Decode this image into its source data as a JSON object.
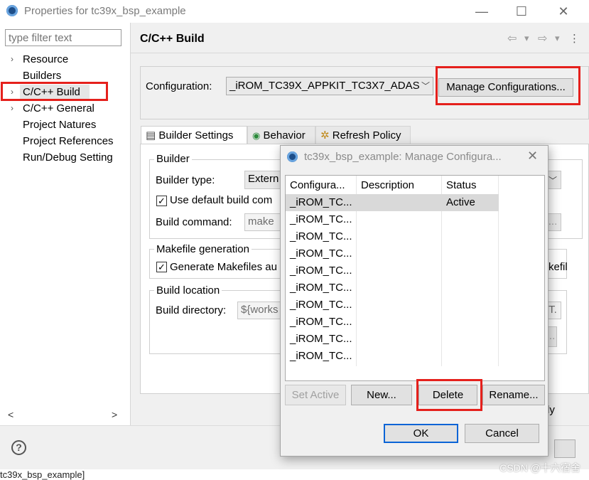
{
  "window": {
    "title": "Properties for tc39x_bsp_example",
    "minimize": "—",
    "maximize": "☐",
    "close": "✕"
  },
  "left": {
    "filter_placeholder": "type filter text",
    "items": [
      {
        "label": "Resource",
        "arrow": "›"
      },
      {
        "label": "Builders",
        "arrow": ""
      },
      {
        "label": "C/C++ Build",
        "arrow": "›"
      },
      {
        "label": "C/C++ General",
        "arrow": "›"
      },
      {
        "label": "Project Natures",
        "arrow": ""
      },
      {
        "label": "Project References",
        "arrow": ""
      },
      {
        "label": "Run/Debug Setting",
        "arrow": ""
      }
    ],
    "scroll_left": "<",
    "scroll_right": ">"
  },
  "page": {
    "title": "C/C++ Build",
    "nav_back": "⇦",
    "nav_fwd": "⇨",
    "nav_drop": "▾"
  },
  "config": {
    "label": "Configuration:",
    "value": "_iROM_TC39X_APPKIT_TC3X7_ADAS",
    "manage_button": "Manage Configurations..."
  },
  "tabs": [
    {
      "label": "Builder Settings",
      "icon": "builder-settings-icon",
      "glyph": "▤"
    },
    {
      "label": "Behavior",
      "icon": "behavior-icon",
      "glyph": "◉"
    },
    {
      "label": "Refresh Policy",
      "icon": "refresh-policy-icon",
      "glyph": "✲"
    }
  ],
  "builder": {
    "group_title": "Builder",
    "type_label": "Builder type:",
    "type_value": "Extern",
    "use_default_label": "Use default build com",
    "command_label": "Build command:",
    "command_value": "make",
    "ellipsis": "..."
  },
  "makefile": {
    "group_title": "Makefile generation",
    "generate_label": "Generate Makefiles au",
    "right_fragment": "kefil"
  },
  "location": {
    "group_title": "Build location",
    "dir_label": "Build directory:",
    "dir_value": "${works",
    "right_fragment": "IT.",
    "ellipsis": "..."
  },
  "apply_fragment": "ly",
  "status_strip": "tc39x_bsp_example]",
  "watermark": "CSDN @十六宿舍",
  "dialog": {
    "title": "tc39x_bsp_example: Manage Configura...",
    "close": "✕",
    "columns": [
      "Configura...",
      "Description",
      "Status"
    ],
    "rows": [
      {
        "name": "_iROM_TC...",
        "description": "",
        "status": "Active"
      },
      {
        "name": "_iROM_TC...",
        "description": "",
        "status": ""
      },
      {
        "name": "_iROM_TC...",
        "description": "",
        "status": ""
      },
      {
        "name": "_iROM_TC...",
        "description": "",
        "status": ""
      },
      {
        "name": "_iROM_TC...",
        "description": "",
        "status": ""
      },
      {
        "name": "_iROM_TC...",
        "description": "",
        "status": ""
      },
      {
        "name": "_iROM_TC...",
        "description": "",
        "status": ""
      },
      {
        "name": "_iROM_TC...",
        "description": "",
        "status": ""
      },
      {
        "name": "_iROM_TC...",
        "description": "",
        "status": ""
      },
      {
        "name": "_iROM_TC...",
        "description": "",
        "status": ""
      }
    ],
    "set_active": "Set Active",
    "new": "New...",
    "delete": "Delete",
    "rename": "Rename...",
    "ok": "OK",
    "cancel": "Cancel"
  },
  "colors": {
    "highlight_red": "#e5201c",
    "selection_gray": "#d9d9d9",
    "ok_border": "#0a64d6"
  }
}
